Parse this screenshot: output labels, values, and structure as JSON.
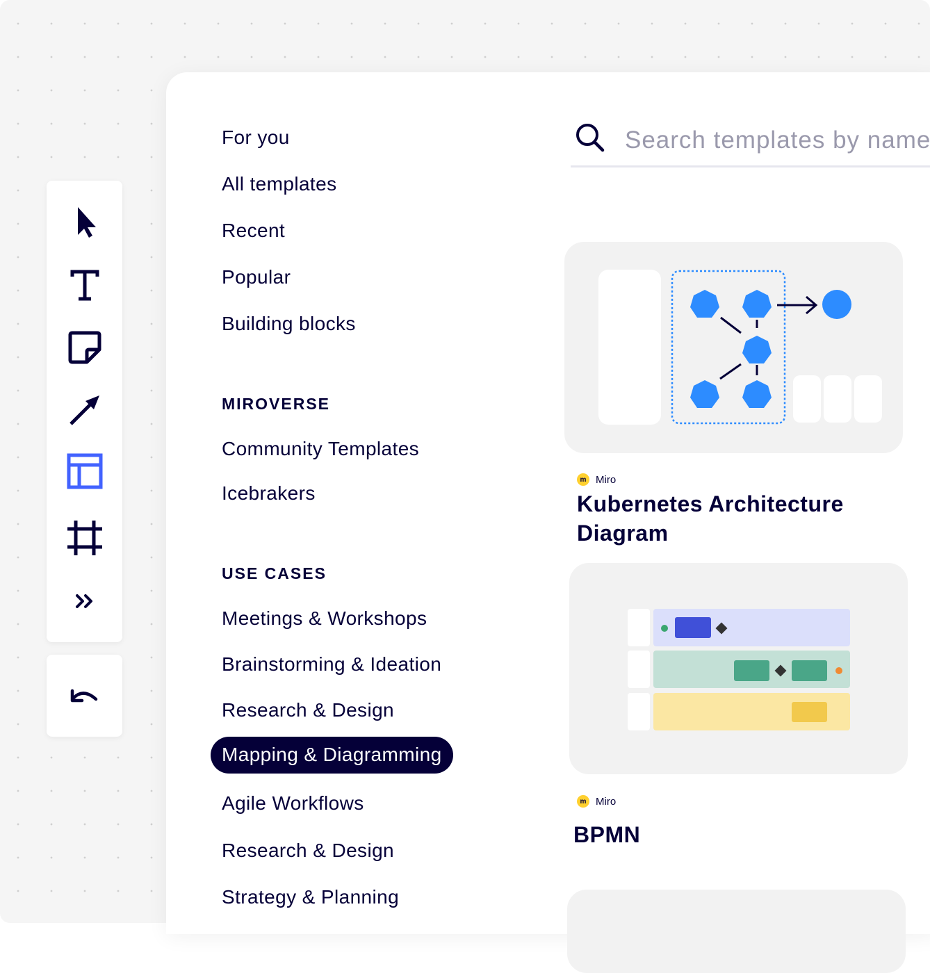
{
  "nav": {
    "items": [
      {
        "label": "For you"
      },
      {
        "label": "All templates"
      },
      {
        "label": "Recent"
      },
      {
        "label": "Popular"
      },
      {
        "label": "Building blocks"
      }
    ],
    "miroverse": {
      "heading": "MIROVERSE",
      "items": [
        {
          "label": "Community Templates"
        },
        {
          "label": "Icebrakers"
        }
      ]
    },
    "use_cases": {
      "heading": "USE CASES",
      "items": [
        {
          "label": "Meetings & Workshops"
        },
        {
          "label": "Brainstorming & Ideation"
        },
        {
          "label": "Research & Design"
        },
        {
          "label": "Mapping & Diagramming",
          "active": true
        },
        {
          "label": "Agile Workflows"
        },
        {
          "label": "Research & Design"
        },
        {
          "label": "Strategy & Planning"
        }
      ]
    }
  },
  "search": {
    "placeholder": "Search templates by name",
    "value": ""
  },
  "toolbar": {
    "tools": [
      {
        "icon": "cursor-icon"
      },
      {
        "icon": "text-icon"
      },
      {
        "icon": "sticky-note-icon"
      },
      {
        "icon": "arrow-icon"
      },
      {
        "icon": "templates-icon",
        "active": true
      },
      {
        "icon": "frame-icon"
      },
      {
        "icon": "more-icon"
      }
    ],
    "undo_icon": "undo-icon"
  },
  "templates": [
    {
      "author": "Miro",
      "title": "Kubernetes Architecture Diagram"
    },
    {
      "author": "Miro",
      "title": "BPMN"
    }
  ],
  "colors": {
    "ink": "#050038",
    "accent_blue": "#4262ff",
    "node_blue": "#2d8cff",
    "miro_yellow": "#ffd02f",
    "lane_purple": "#dbdffb",
    "lane_green": "#c3e0d6",
    "lane_yellow": "#fbe7a3"
  }
}
